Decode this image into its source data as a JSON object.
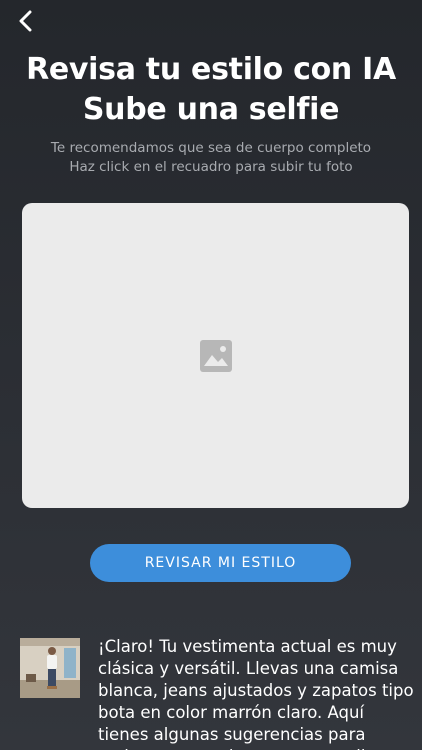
{
  "header": {
    "back_icon": "chevron-left-icon",
    "title_line1": "Revisa tu estilo con IA",
    "title_line2": "Sube una selfie"
  },
  "instructions": {
    "line1": "Te recomendamos que sea de cuerpo completo",
    "line2": "Haz click en el recuadro para subir tu foto"
  },
  "upload": {
    "placeholder_icon": "image-placeholder-icon"
  },
  "actions": {
    "review_label": "REVISAR MI ESTILO"
  },
  "result": {
    "thumbnail": "outfit-photo-thumbnail",
    "text": "¡Claro! Tu vestimenta actual es muy clásica y versátil. Llevas una camisa blanca, jeans ajustados y zapatos tipo bota en color marrón claro. Aquí tienes algunas sugerencias para mejorar o complementar tu estilo:"
  },
  "colors": {
    "background": "#2a2d32",
    "button": "#3d8edb",
    "upload_box": "#ebebeb",
    "subtitle_text": "#a8abb0"
  }
}
